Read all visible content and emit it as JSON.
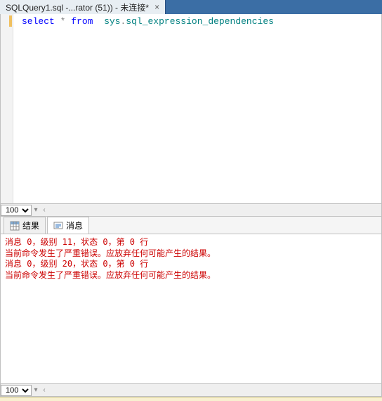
{
  "tab": {
    "title": "SQLQuery1.sql -...rator (51)) - 未连接*"
  },
  "editor": {
    "code_keyword1": "select",
    "code_op": "*",
    "code_keyword2": "from",
    "code_sys": "sys",
    "code_dot": ".",
    "code_obj": "sql_expression_dependencies"
  },
  "zoom": {
    "top": "100 %",
    "bottom": "100 %"
  },
  "resultTabs": {
    "results": "结果",
    "messages": "消息"
  },
  "messages": [
    "消息 0，级别 11，状态 0，第 0 行",
    "当前命令发生了严重错误。应放弃任何可能产生的结果。",
    "消息 0，级别 20，状态 0，第 0 行",
    "当前命令发生了严重错误。应放弃任何可能产生的结果。"
  ]
}
